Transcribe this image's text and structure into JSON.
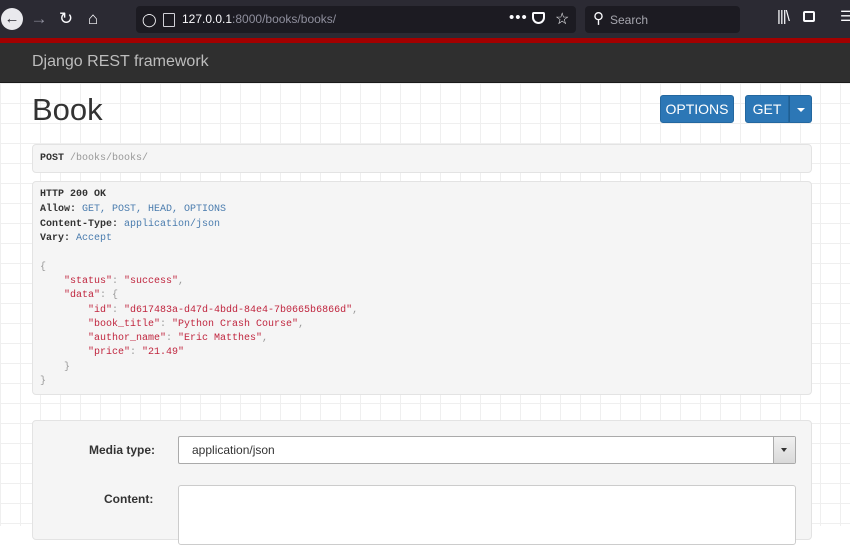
{
  "browser": {
    "url_host": "127.0.0.1",
    "url_rest": ":8000/books/books/",
    "search_placeholder": "Search",
    "icons": [
      "back-icon",
      "forward-icon",
      "reload-icon",
      "home-icon",
      "shield-icon",
      "page-info-icon",
      "page-actions-icon",
      "pocket-icon",
      "bookmark-star-icon",
      "search-icon",
      "library-icon",
      "sidebar-icon",
      "menu-icon"
    ]
  },
  "navbar": {
    "brand": "Django REST framework"
  },
  "page": {
    "title": "Book",
    "options_label": "OPTIONS",
    "get_label": "GET"
  },
  "request": {
    "method": "POST",
    "path": "/books/books/"
  },
  "response": {
    "status_line": "HTTP 200 OK",
    "headers": [
      {
        "name": "Allow:",
        "value": "GET, POST, HEAD, OPTIONS"
      },
      {
        "name": "Content-Type:",
        "value": "application/json"
      },
      {
        "name": "Vary:",
        "value": "Accept"
      }
    ],
    "body": {
      "open": "{",
      "close": "}",
      "status_key": "\"status\"",
      "status_value": "\"success\"",
      "data_key": "\"data\"",
      "data_open": "{",
      "data_close": "}",
      "fields": [
        {
          "key": "\"id\"",
          "value": "\"d617483a-d47d-4bdd-84e4-7b0665b6866d\"",
          "comma": ","
        },
        {
          "key": "\"book_title\"",
          "value": "\"Python Crash Course\"",
          "comma": ","
        },
        {
          "key": "\"author_name\"",
          "value": "\"Eric Matthes\"",
          "comma": ","
        },
        {
          "key": "\"price\"",
          "value": "\"21.49\"",
          "comma": ""
        }
      ]
    }
  },
  "form": {
    "media_type_label": "Media type:",
    "media_type_value": "application/json",
    "content_label": "Content:",
    "content_value": ""
  },
  "colors": {
    "accent": "#2c77b6",
    "brand_strip": "#a30000",
    "navbar": "#2f2f2f",
    "json_string": "#c0263f",
    "header_value": "#4a7cae"
  }
}
